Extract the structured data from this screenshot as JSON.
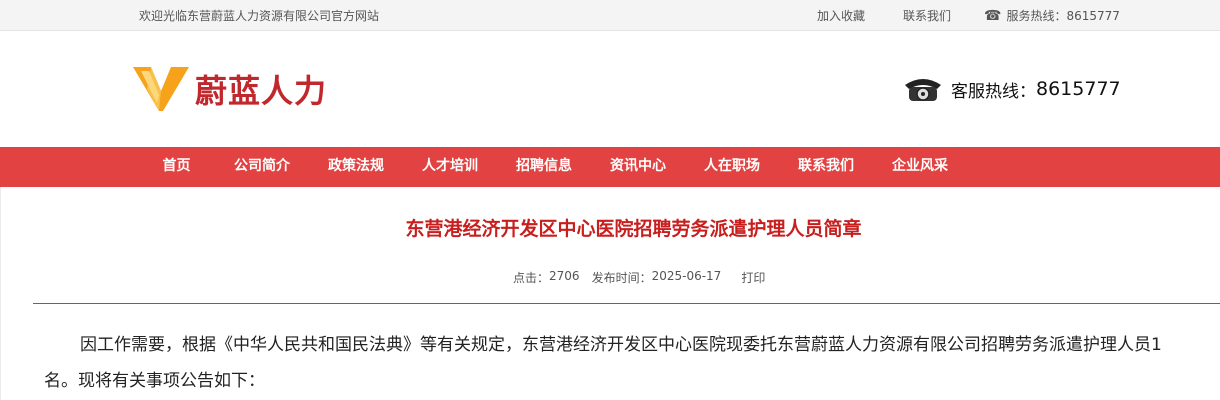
{
  "topbar": {
    "welcome": "欢迎光临东营蔚蓝人力资源有限公司官方网站",
    "favorite": "加入收藏",
    "contact": "联系我们",
    "hotline_label": "服务热线：",
    "hotline_number": "8615777"
  },
  "header": {
    "brand": "蔚蓝人力",
    "service_label": "客服热线：",
    "service_number": "8615777"
  },
  "nav": [
    "首页",
    "公司简介",
    "政策法规",
    "人才培训",
    "招聘信息",
    "资讯中心",
    "人在职场",
    "联系我们",
    "企业风采"
  ],
  "article": {
    "title": "东营港经济开发区中心医院招聘劳务派遣护理人员简章",
    "clicks_label": "点击：",
    "clicks": "2706",
    "date_label": "发布时间：",
    "date": "2025-06-17",
    "print": "打印",
    "para_line1": "因工作需要，根据《中华人民共和国民法典》等有关规定，东营港经济开发区中心医院现委托东营蔚蓝人力资源有限公司招聘劳务派遣护理人员1",
    "para_line2": "名。现将有关事项公告如下："
  },
  "colors": {
    "nav_bg": "#e24242",
    "title": "#c81e1e",
    "brand": "#c0282d",
    "logo_orange": "#f6a21b"
  }
}
